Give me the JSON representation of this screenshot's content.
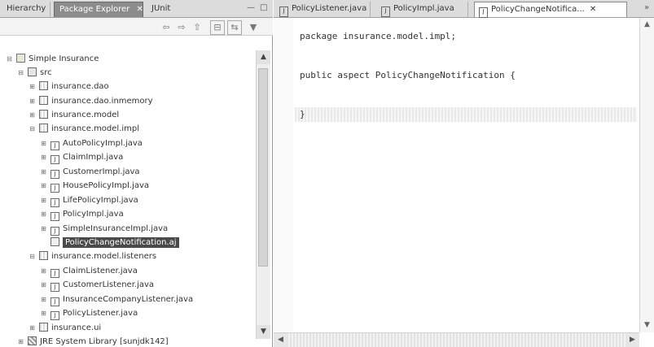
{
  "left_view": {
    "tabs": [
      {
        "label": "Hierarchy",
        "close": ""
      },
      {
        "label": "Package Explorer",
        "close": "✕"
      },
      {
        "label": "JUnit",
        "close": ""
      }
    ],
    "controls": {
      "minimize": "—",
      "maximize": "□"
    },
    "toolbar": {
      "back": "⇦",
      "forward": "⇨",
      "up": "⇧",
      "collapse_all": "⊟",
      "link": "⇆",
      "menu": "▼"
    }
  },
  "tree": [
    {
      "label": "Simple Insurance",
      "icon": "project-icon",
      "expander": "⊟"
    },
    {
      "label": "src",
      "icon": "source-folder-icon",
      "expander": "⊟"
    },
    {
      "label": "insurance.dao",
      "icon": "package-icon",
      "expander": "⊞"
    },
    {
      "label": "insurance.dao.inmemory",
      "icon": "package-icon",
      "expander": "⊞"
    },
    {
      "label": "insurance.model",
      "icon": "package-icon",
      "expander": "⊞"
    },
    {
      "label": "insurance.model.impl",
      "icon": "package-icon",
      "expander": "⊟"
    },
    {
      "label": "AutoPolicyImpl.java",
      "icon": "java-file-icon",
      "expander": "⊞"
    },
    {
      "label": "ClaimImpl.java",
      "icon": "java-file-icon",
      "expander": "⊞"
    },
    {
      "label": "CustomerImpl.java",
      "icon": "java-file-icon",
      "expander": "⊞"
    },
    {
      "label": "HousePolicyImpl.java",
      "icon": "java-file-icon",
      "expander": "⊞"
    },
    {
      "label": "LifePolicyImpl.java",
      "icon": "java-file-icon",
      "expander": "⊞"
    },
    {
      "label": "PolicyImpl.java",
      "icon": "java-file-icon",
      "expander": "⊞"
    },
    {
      "label": "SimpleInsuranceImpl.java",
      "icon": "java-file-icon",
      "expander": "⊞"
    },
    {
      "label": "PolicyChangeNotification.aj",
      "icon": "aspect-file-icon",
      "expander": ""
    },
    {
      "label": "insurance.model.listeners",
      "icon": "package-icon",
      "expander": "⊟"
    },
    {
      "label": "ClaimListener.java",
      "icon": "java-file-icon",
      "expander": "⊞"
    },
    {
      "label": "CustomerListener.java",
      "icon": "java-file-icon",
      "expander": "⊞"
    },
    {
      "label": "InsuranceCompanyListener.java",
      "icon": "java-file-icon",
      "expander": "⊞"
    },
    {
      "label": "PolicyListener.java",
      "icon": "java-file-icon",
      "expander": "⊞"
    },
    {
      "label": "insurance.ui",
      "icon": "package-icon",
      "expander": "⊞"
    },
    {
      "label": "JRE System Library [sunjdk142]",
      "icon": "library-icon",
      "expander": "⊞"
    }
  ],
  "tree_scroll": {
    "up": "▲",
    "down": "▼"
  },
  "editor": {
    "tabs": [
      {
        "label": "PolicyListener.java",
        "icon": "J",
        "close": ""
      },
      {
        "label": "PolicyImpl.java",
        "icon": "J",
        "close": ""
      },
      {
        "label": "PolicyChangeNotifica...",
        "icon": "J",
        "close": "✕"
      }
    ],
    "overflow": "»",
    "code_lines": [
      "package insurance.model.impl;",
      "",
      "public aspect PolicyChangeNotification {",
      "",
      "}"
    ],
    "scroll": {
      "up": "▲",
      "down": "▼",
      "left": "◀",
      "right": "▶"
    }
  }
}
